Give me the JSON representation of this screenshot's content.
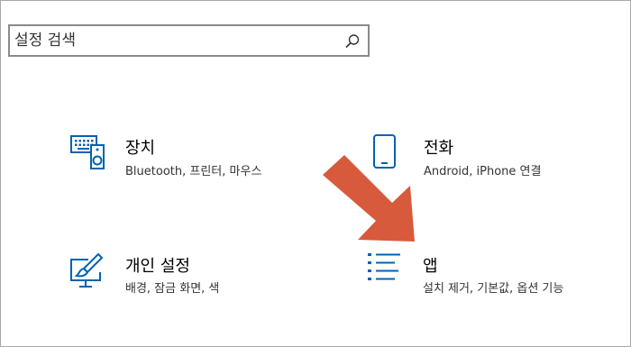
{
  "search": {
    "placeholder": "설정 검색",
    "icon": "search-icon"
  },
  "tiles": [
    {
      "id": "devices",
      "title": "장치",
      "desc": "Bluetooth, 프린터, 마우스",
      "icon": "keyboard-speaker-icon"
    },
    {
      "id": "phone",
      "title": "전화",
      "desc": "Android, iPhone 연결",
      "icon": "phone-icon"
    },
    {
      "id": "personalization",
      "title": "개인 설정",
      "desc": "배경, 잠금 화면, 색",
      "icon": "paint-monitor-icon"
    },
    {
      "id": "apps",
      "title": "앱",
      "desc": "설치 제거, 기본값, 옵션 기능",
      "icon": "apps-list-icon"
    }
  ],
  "colors": {
    "accent": "#0063b1",
    "arrow": "#d75a3c",
    "border": "#8a8a8a"
  }
}
